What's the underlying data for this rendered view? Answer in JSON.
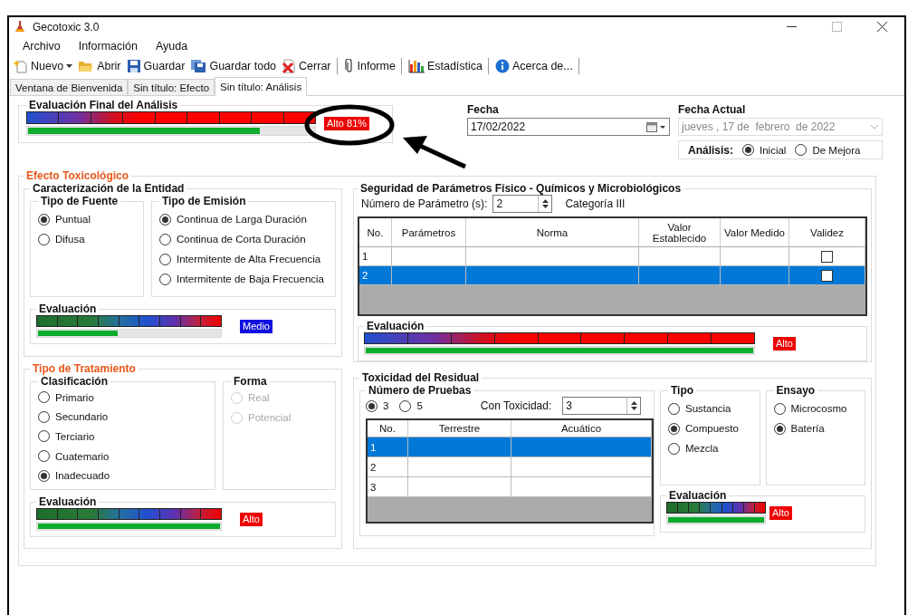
{
  "window": {
    "title": "Gecotoxic 3.0"
  },
  "menu": [
    "Archivo",
    "Información",
    "Ayuda"
  ],
  "toolbar": [
    {
      "label": "Nuevo",
      "kind": "new",
      "dropdown": true,
      "separator_after": false
    },
    {
      "label": "Abrir",
      "kind": "open",
      "dropdown": false,
      "separator_after": false
    },
    {
      "label": "Guardar",
      "kind": "save",
      "dropdown": false,
      "separator_after": false
    },
    {
      "label": "Guardar todo",
      "kind": "save-all",
      "dropdown": false,
      "separator_after": false
    },
    {
      "label": "Cerrar",
      "kind": "close",
      "dropdown": false,
      "separator_after": true
    },
    {
      "label": "Informe",
      "kind": "attach",
      "dropdown": false,
      "separator_after": true
    },
    {
      "label": "Estadística",
      "kind": "chart",
      "dropdown": false,
      "separator_after": true
    },
    {
      "label": "Acerca de...",
      "kind": "info",
      "dropdown": false,
      "separator_after": true
    }
  ],
  "tabs": [
    {
      "label": "Ventana de Bienvenida",
      "selected": false
    },
    {
      "label": "Sin título: Efecto",
      "selected": false
    },
    {
      "label": "Sin título: Análisis",
      "selected": true
    }
  ],
  "final_evaluation": {
    "title": "Evaluación Final del Análisis",
    "kind": "blue-red",
    "level": 0.81,
    "badge": {
      "text": "Alto 81%",
      "color": "#ee0000"
    }
  },
  "fecha": {
    "label": "Fecha",
    "value": "17/02/2022"
  },
  "fecha_actual": {
    "label": "Fecha Actual",
    "value": "jueves , 17 de  febrero  de 2022",
    "disabled": true
  },
  "analisis": {
    "label": "Análisis:",
    "options": [
      {
        "label": "Inicial",
        "selected": true
      },
      {
        "label": "De Mejora",
        "selected": false
      }
    ]
  },
  "efecto": {
    "title": "Efecto Toxicológico",
    "entidad": {
      "title": "Caracterización de la Entidad",
      "fuente": {
        "title": "Tipo de Fuente",
        "options": [
          {
            "label": "Puntual",
            "selected": true
          },
          {
            "label": "Difusa",
            "selected": false
          }
        ]
      },
      "emision": {
        "title": "Tipo de Emisión",
        "options": [
          {
            "label": "Continua de Larga Duración",
            "selected": true
          },
          {
            "label": "Continua de Corta Duración",
            "selected": false
          },
          {
            "label": "Intermitente de Alta Frecuencia",
            "selected": false
          },
          {
            "label": "Intermitente de Baja Frecuencia",
            "selected": false
          }
        ]
      },
      "evaluation": {
        "title": "Evaluación",
        "kind": "green-red",
        "level": 0.44,
        "badge": {
          "text": "Medio",
          "color": "#1010e0"
        }
      }
    },
    "seguridad": {
      "title": "Seguridad de Parámetros Físico - Químicos y Microbiológicos",
      "count_label": "Número de Parámetro (s):",
      "count": "2",
      "category": "Categoría III",
      "table": {
        "columns": [
          "No.",
          "Parámetros",
          "Norma",
          "Valor Establecido",
          "Valor Medido",
          "Validez"
        ],
        "rows": [
          {
            "no": "1",
            "selected": false,
            "checked": false
          },
          {
            "no": "2",
            "selected": true,
            "checked": false
          }
        ]
      },
      "evaluation": {
        "title": "Evaluación",
        "kind": "blue-red",
        "level": 1,
        "badge": {
          "text": "Alto",
          "color": "#ee0000"
        }
      }
    }
  },
  "tratamiento": {
    "title": "Tipo de Tratamiento",
    "clasificacion": {
      "title": "Clasificación",
      "options": [
        {
          "label": "Primario",
          "selected": false
        },
        {
          "label": "Secundario",
          "selected": false
        },
        {
          "label": "Terciario",
          "selected": false
        },
        {
          "label": "Cuatemario",
          "selected": false
        },
        {
          "label": "Inadecuado",
          "selected": true
        }
      ]
    },
    "forma": {
      "title": "Forma",
      "options": [
        {
          "label": "Real",
          "selected": false,
          "disabled": true
        },
        {
          "label": "Potencial",
          "selected": false,
          "disabled": true
        }
      ]
    },
    "evaluation": {
      "title": "Evaluación",
      "kind": "green-red",
      "level": 1,
      "badge": {
        "text": "Alto",
        "color": "#ee0000"
      }
    }
  },
  "residual": {
    "title": "Toxicidad del Residual",
    "pruebas": {
      "title": "Número de Pruebas",
      "options": [
        {
          "label": "3",
          "selected": true
        },
        {
          "label": "5",
          "selected": false
        }
      ],
      "toxicity_label": "Con Toxicidad:",
      "toxicity": "3",
      "table": {
        "columns": [
          "No.",
          "Terrestre",
          "Acuático"
        ],
        "rows": [
          {
            "no": "1",
            "selected": true
          },
          {
            "no": "2",
            "selected": false
          },
          {
            "no": "3",
            "selected": false
          }
        ]
      }
    },
    "tipo": {
      "title": "Tipo",
      "options": [
        {
          "label": "Sustancia",
          "selected": false
        },
        {
          "label": "Compuesto",
          "selected": true
        },
        {
          "label": "Mezcla",
          "selected": false
        }
      ]
    },
    "ensayo": {
      "title": "Ensayo",
      "options": [
        {
          "label": "Microcosmo",
          "selected": false
        },
        {
          "label": "Batería",
          "selected": true
        }
      ]
    },
    "evaluation": {
      "title": "Evaluación",
      "kind": "green-red",
      "level": 1,
      "badge": {
        "text": "Alto",
        "color": "#ee0000"
      }
    }
  }
}
